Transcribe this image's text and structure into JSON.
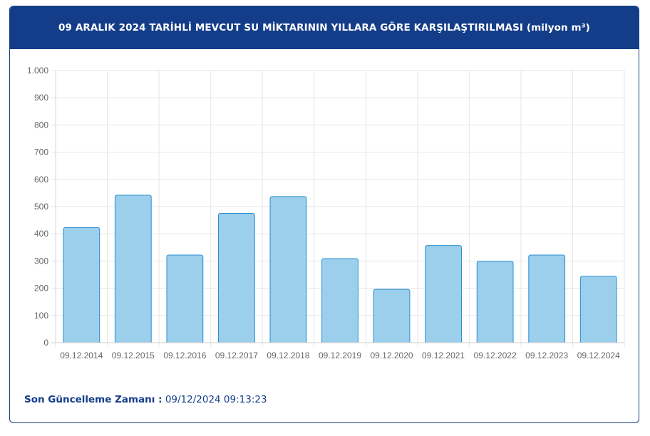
{
  "header": {
    "title": "09 ARALIK 2024 TARİHLİ MEVCUT SU MİKTARININ YILLARA GÖRE KARŞILAŞTIRILMASI (milyon m³)"
  },
  "footer": {
    "label": "Son Güncelleme Zamanı :",
    "value": "09/12/2024 09:13:23"
  },
  "colors": {
    "header_bg": "#143d89",
    "bar_fill": "#9ccfec",
    "bar_stroke": "#2a8fd0",
    "grid": "#e6e6e6"
  },
  "chart_data": {
    "type": "bar",
    "title": "09 ARALIK 2024 TARİHLİ MEVCUT SU MİKTARININ YILLARA GÖRE KARŞILAŞTIRILMASI (milyon m³)",
    "xlabel": "",
    "ylabel": "",
    "categories": [
      "09.12.2014",
      "09.12.2015",
      "09.12.2016",
      "09.12.2017",
      "09.12.2018",
      "09.12.2019",
      "09.12.2020",
      "09.12.2021",
      "09.12.2022",
      "09.12.2023",
      "09.12.2024"
    ],
    "values": [
      423,
      542,
      322,
      475,
      537,
      309,
      196,
      357,
      299,
      322,
      244
    ],
    "ylim": [
      0,
      1000
    ],
    "yticks": [
      0,
      100,
      200,
      300,
      400,
      500,
      600,
      700,
      800,
      900,
      1000
    ],
    "ytick_labels": [
      "0",
      "100",
      "200",
      "300",
      "400",
      "500",
      "600",
      "700",
      "800",
      "900",
      "1.000"
    ],
    "grid": true,
    "legend": "none"
  }
}
